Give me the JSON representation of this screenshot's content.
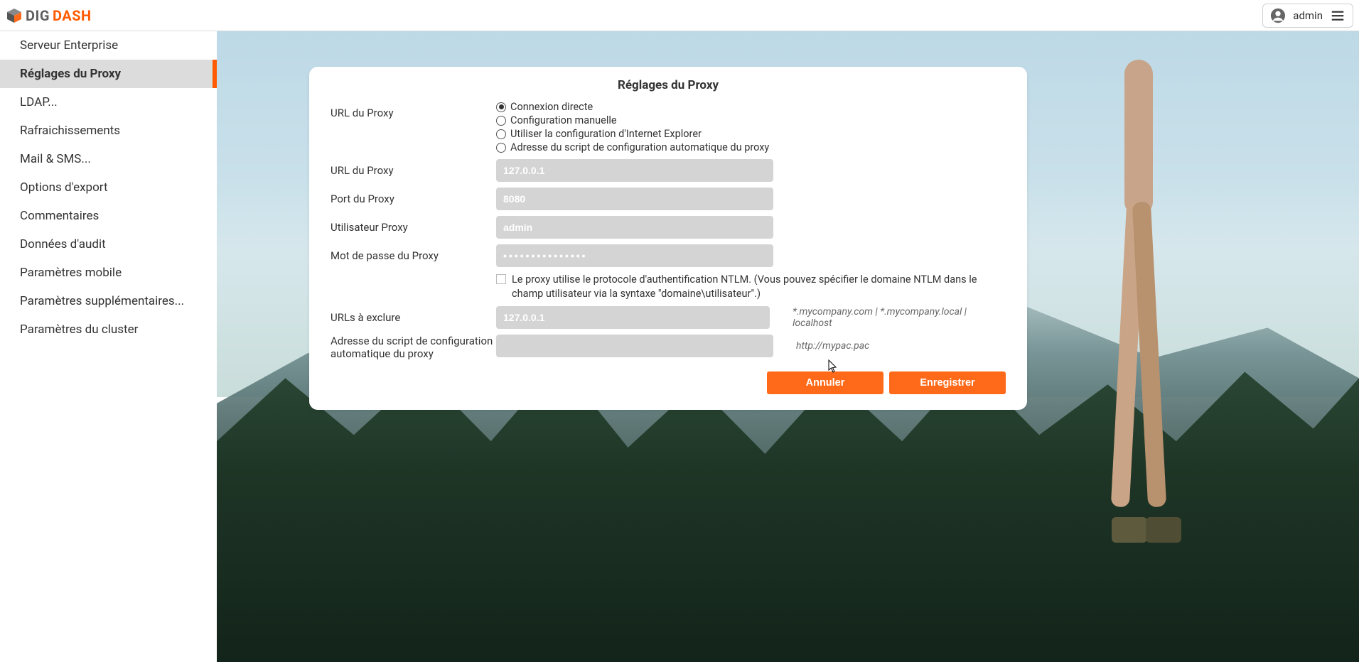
{
  "header": {
    "brand_prefix": "DIG",
    "brand_suffix": "DASH",
    "user_name": "admin"
  },
  "sidebar": {
    "items": [
      {
        "label": "Serveur Enterprise",
        "active": false
      },
      {
        "label": "Réglages du Proxy",
        "active": true
      },
      {
        "label": "LDAP...",
        "active": false
      },
      {
        "label": "Rafraichissements",
        "active": false
      },
      {
        "label": "Mail & SMS...",
        "active": false
      },
      {
        "label": "Options d'export",
        "active": false
      },
      {
        "label": "Commentaires",
        "active": false
      },
      {
        "label": "Données d'audit",
        "active": false
      },
      {
        "label": "Paramètres mobile",
        "active": false
      },
      {
        "label": "Paramètres supplémentaires...",
        "active": false
      },
      {
        "label": "Paramètres du cluster",
        "active": false
      }
    ]
  },
  "card": {
    "title": "Réglages du Proxy",
    "labels": {
      "proxy_url_mode": "URL du Proxy",
      "proxy_url": "URL du Proxy",
      "proxy_port": "Port du Proxy",
      "proxy_user": "Utilisateur Proxy",
      "proxy_password": "Mot de passe du Proxy",
      "urls_exclude": "URLs à exclure",
      "pac_address": "Adresse du script de configuration automatique du proxy"
    },
    "radio_options": [
      "Connexion directe",
      "Configuration manuelle",
      "Utiliser la configuration d'Internet Explorer",
      "Adresse du script de configuration automatique du proxy"
    ],
    "radio_selected_index": 0,
    "fields": {
      "proxy_url_value": "127.0.0.1",
      "proxy_port_value": "8080",
      "proxy_user_value": "admin",
      "proxy_password_value": "•••••••••••••••",
      "urls_exclude_value": "127.0.0.1",
      "pac_value": ""
    },
    "ntlm_checkbox_label": "Le proxy utilise le protocole d'authentification NTLM. (Vous pouvez spécifier le domaine NTLM dans le champ utilisateur via la syntaxe \"domaine\\utilisateur\".)",
    "ntlm_checked": false,
    "hints": {
      "urls_exclude": "*.mycompany.com | *.mycompany.local | localhost",
      "pac": "http://mypac.pac"
    },
    "buttons": {
      "cancel": "Annuler",
      "save": "Enregistrer"
    }
  },
  "colors": {
    "accent": "#ff5a00",
    "button": "#ff6a1a"
  }
}
